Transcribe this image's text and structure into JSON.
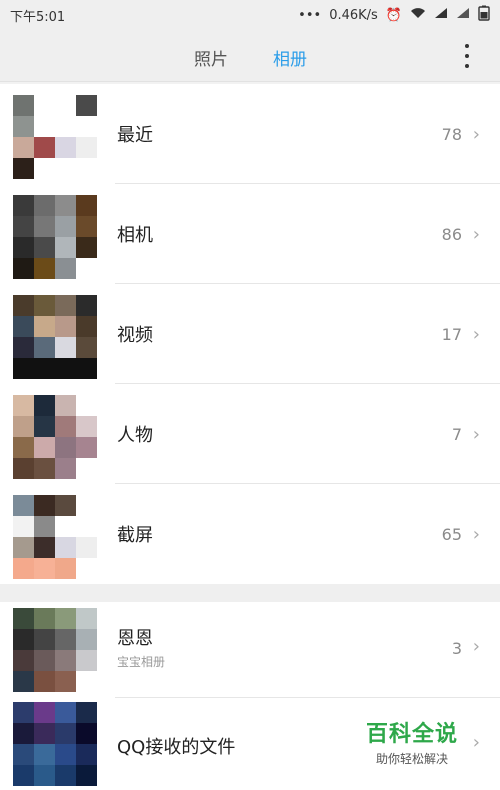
{
  "status": {
    "time": "下午5:01",
    "dots": "•••",
    "speed": "0.46K/s"
  },
  "tabs": {
    "photos": "照片",
    "albums": "相册"
  },
  "albums": [
    {
      "name": "最近",
      "count": "78"
    },
    {
      "name": "相机",
      "count": "86"
    },
    {
      "name": "视频",
      "count": "17"
    },
    {
      "name": "人物",
      "count": "7"
    },
    {
      "name": "截屏",
      "count": "65"
    }
  ],
  "other_albums": [
    {
      "name": "恩恩",
      "subtitle": "宝宝相册",
      "count": "3"
    },
    {
      "name": "QQ接收的文件",
      "count": ""
    }
  ],
  "watermark": {
    "title": "百科全说",
    "subtitle": "助你轻松解决"
  },
  "colors": {
    "accent": "#2b9de9",
    "watermark": "#2ea84a"
  }
}
